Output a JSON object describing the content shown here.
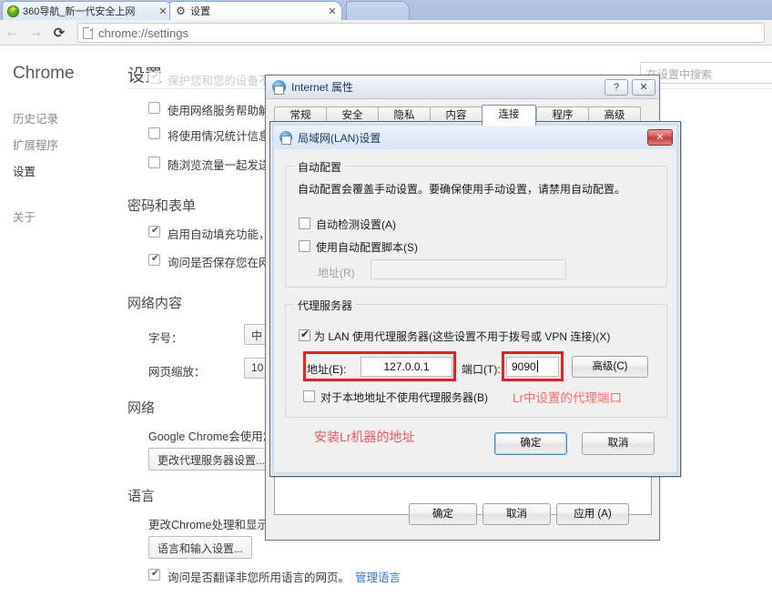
{
  "browser": {
    "tabs": [
      {
        "title": "360导航_新一代安全上网",
        "icon": "360-favicon",
        "close": "✕"
      },
      {
        "title": "设置",
        "icon": "gear-icon",
        "close": "✕"
      },
      {
        "title": "",
        "icon": "",
        "close": ""
      }
    ],
    "nav": {
      "back": "←",
      "forward": "→",
      "reload": "⟳"
    },
    "omnibox": {
      "value": "chrome://settings",
      "icon": "page-icon"
    }
  },
  "settings": {
    "brand": "Chrome",
    "sidebar": [
      {
        "label": "历史记录",
        "active": false
      },
      {
        "label": "扩展程序",
        "active": false
      },
      {
        "label": "设置",
        "active": true
      },
      {
        "label": "关于",
        "active": false
      }
    ],
    "page_title": "设置",
    "search_placeholder": "在设置中搜索",
    "privacy_rows": [
      {
        "label": "保护您和您的设备不",
        "checked": true,
        "faded": true
      },
      {
        "label": "使用网络服务帮助解",
        "checked": false,
        "faded": false
      },
      {
        "label": "将使用情况统计信息",
        "checked": false,
        "faded": false
      },
      {
        "label": "随浏览流量一起发送",
        "checked": false,
        "faded": false
      }
    ],
    "passwords_heading": "密码和表单",
    "password_rows": [
      {
        "label": "启用自动填充功能，",
        "checked": true
      },
      {
        "label": "询问是否保存您在网",
        "checked": true
      }
    ],
    "webcontent_heading": "网络内容",
    "fontsize_label": "字号：",
    "fontsize_value": "中",
    "pagezoom_label": "网页缩放：",
    "pagezoom_value": "10",
    "network_heading": "网络",
    "network_desc": "Google Chrome会使用您",
    "proxy_button": "更改代理服务器设置...",
    "language_heading": "语言",
    "language_desc": "更改Chrome处理和显示",
    "language_button": "语言和输入设置...",
    "translate_row": {
      "label": "询问是否翻译非您所用语言的网页。",
      "checked": true,
      "link": "管理语言"
    }
  },
  "ie_dialog": {
    "title": "Internet 属性",
    "icon": "internet-properties-icon",
    "help_button": "?",
    "close_button": "✕",
    "tabs": [
      {
        "label": "常规",
        "selected": false
      },
      {
        "label": "安全",
        "selected": false
      },
      {
        "label": "隐私",
        "selected": false
      },
      {
        "label": "内容",
        "selected": false
      },
      {
        "label": "连接",
        "selected": true
      },
      {
        "label": "程序",
        "selected": false
      },
      {
        "label": "高级",
        "selected": false
      }
    ],
    "buttons": {
      "ok": "确定",
      "cancel": "取消",
      "apply": "应用 (A)"
    }
  },
  "lan_dialog": {
    "title": "局域网(LAN)设置",
    "icon": "internet-properties-icon",
    "close_button": "✕",
    "autoconfig": {
      "group_label": "自动配置",
      "description": "自动配置会覆盖手动设置。要确保使用手动设置，请禁用自动配置。",
      "auto_detect": {
        "label": "自动检测设置(A)",
        "accel": "A",
        "checked": false
      },
      "use_script": {
        "label": "使用自动配置脚本(S)",
        "accel": "S",
        "checked": false
      },
      "address_label": "地址(R)",
      "address_value": "",
      "address_enabled": false
    },
    "proxy": {
      "group_label": "代理服务器",
      "use_proxy": {
        "label": "为 LAN 使用代理服务器(这些设置不用于拨号或 VPN 连接)(X)",
        "checked": true
      },
      "address_label": "地址(E):",
      "address_value": "127.0.0.1",
      "port_label": "端口(T):",
      "port_value": "9090",
      "advanced_button": "高级(C)",
      "bypass_local": {
        "label": "对于本地地址不使用代理服务器(B)",
        "checked": false
      }
    },
    "annotations": [
      {
        "text": "Lr中设置的代理端口",
        "color": "#fa6b6b"
      },
      {
        "text": "安装Lr机器的地址",
        "color": "#f4555a"
      }
    ],
    "buttons": {
      "ok": "确定",
      "cancel": "取消"
    }
  },
  "colors": {
    "annotation_red": "#f4555a",
    "highlight_box_red": "#ee1c1c",
    "link_blue": "#2b7bd0",
    "tabstrip_blue": "#aabedf"
  }
}
